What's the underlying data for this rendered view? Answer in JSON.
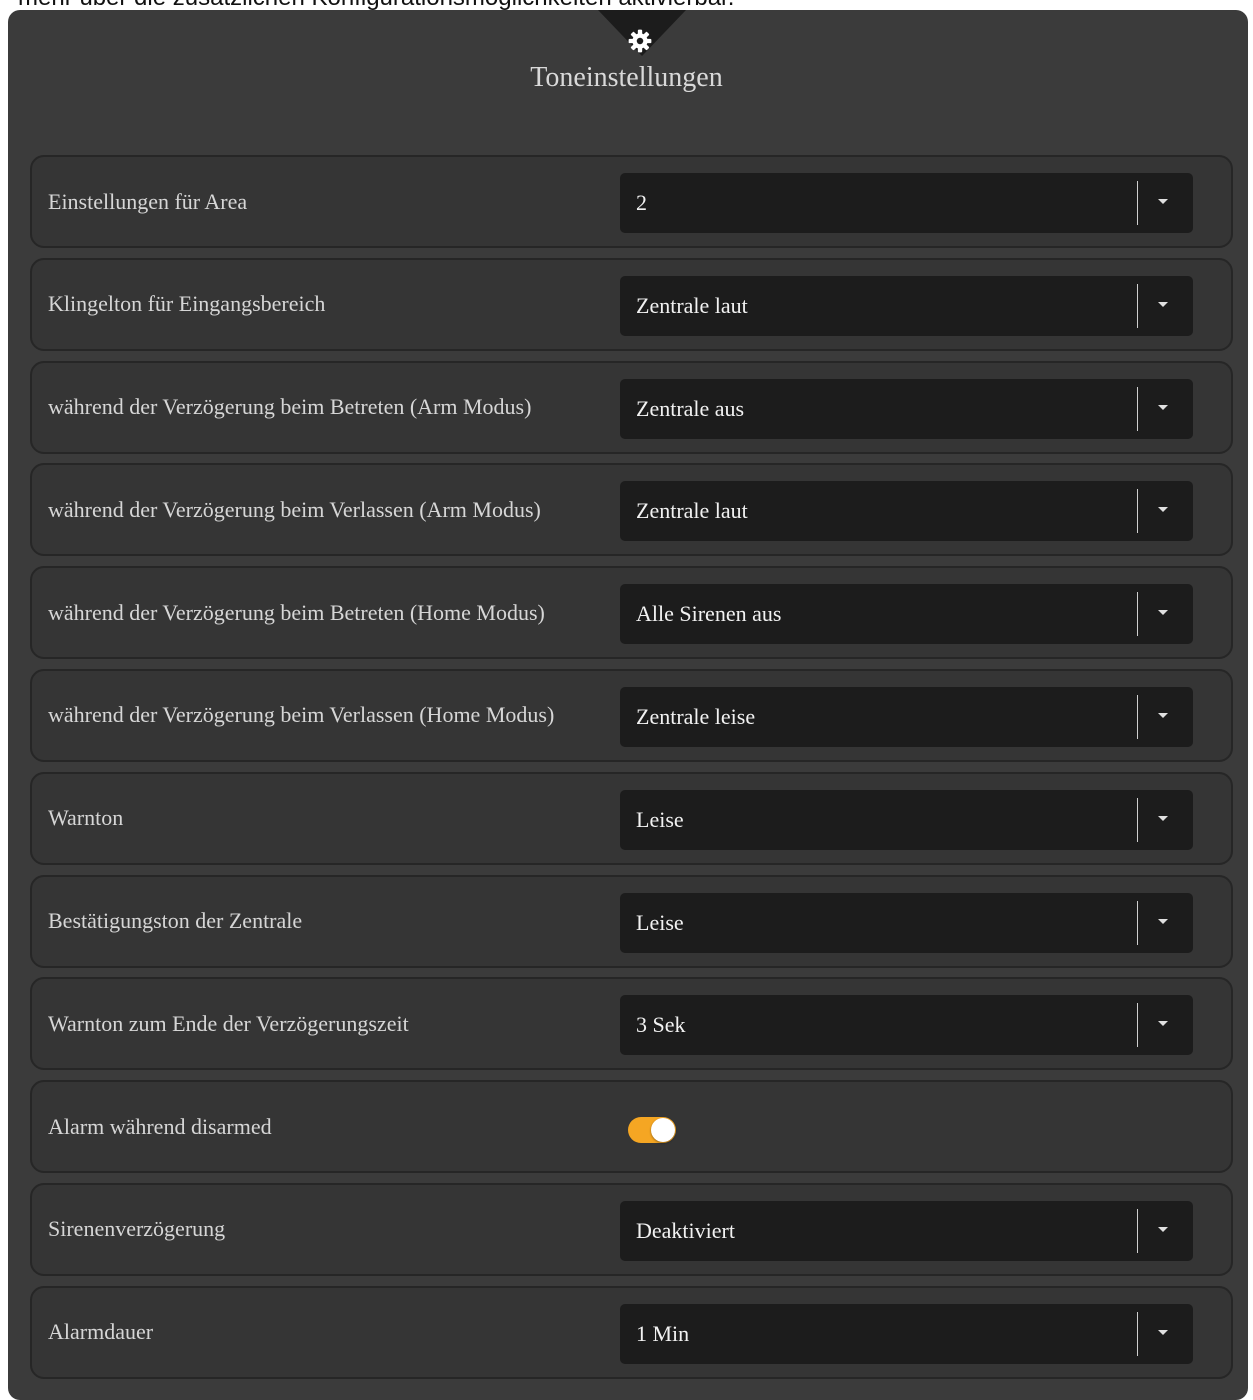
{
  "caption": "mehr über die zusätzlichen Konfigurationsmöglichkeiten aktivierbar.",
  "header": {
    "icon": "gear-icon",
    "title": "Toneinstellungen"
  },
  "colors": {
    "panel": "#3b3b3b",
    "row": "#353535",
    "select": "#1c1c1c",
    "toggle_on": "#f5a623"
  },
  "rows": [
    {
      "label": "Einstellungen für Area",
      "value": "2"
    },
    {
      "label": "Klingelton für Eingangsbereich",
      "value": "Zentrale laut"
    },
    {
      "label": "während der Verzögerung beim Betreten (Arm Modus)",
      "value": "Zentrale aus"
    },
    {
      "label": "während der Verzögerung beim Verlassen (Arm Modus)",
      "value": "Zentrale laut"
    },
    {
      "label": "während der Verzögerung beim Betreten (Home Modus)",
      "value": "Alle Sirenen aus"
    },
    {
      "label": "während der Verzögerung beim Verlassen (Home Modus)",
      "value": "Zentrale leise"
    },
    {
      "label": "Warnton",
      "value": "Leise"
    },
    {
      "label": "Bestätigungston der Zentrale",
      "value": "Leise"
    },
    {
      "label": "Warnton zum Ende der Verzögerungszeit",
      "value": "3 Sek"
    },
    {
      "label": "Alarm während disarmed",
      "toggle_on": true
    },
    {
      "label": "Sirenenverzögerung",
      "value": "Deaktiviert"
    },
    {
      "label": "Alarmdauer",
      "value": "1 Min"
    }
  ]
}
